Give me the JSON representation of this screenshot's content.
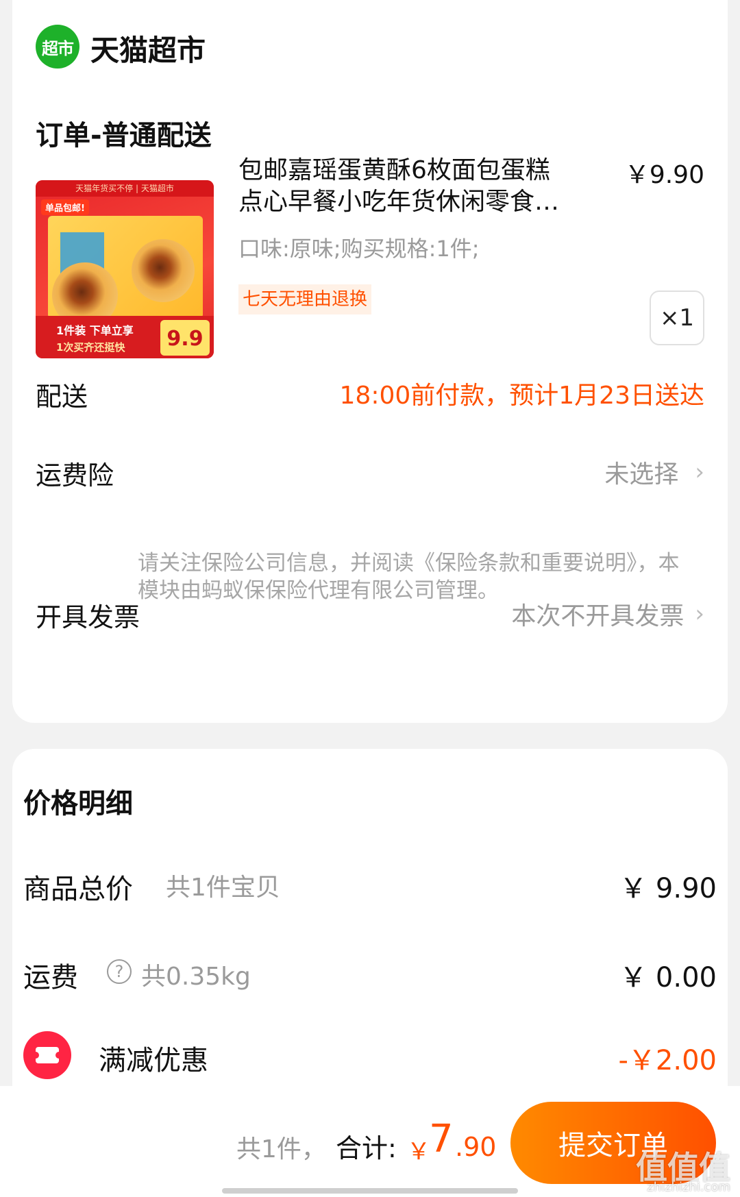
{
  "store": {
    "logo_text": "超市",
    "name": "天猫超市"
  },
  "order_section": {
    "title": "订单-普通配送"
  },
  "product": {
    "title_line1": "包邮嘉瑶蛋黄酥6枚面包蛋糕",
    "title_line2": "点心早餐小吃年货休闲零食2…",
    "price": "￥9.90",
    "spec": "口味:原味;购买规格:1件;",
    "return_tag": "七天无理由退换",
    "quantity": "×1",
    "thumb": {
      "banner": "天猫年货买不停 | 天猫超市",
      "free_tag": "单品包邮!",
      "promo_line1": "1件装 下单立享",
      "promo_line2": "1次买齐还挺快",
      "price": "9.9"
    }
  },
  "delivery": {
    "label": "配送",
    "value": "18:00前付款，预计1月23日送达"
  },
  "shipping_insurance": {
    "label": "运费险",
    "value": "未选择",
    "note": "请关注保险公司信息，并阅读《保险条款和重要说明》，本模块由蚂蚁保保险代理有限公司管理。"
  },
  "invoice": {
    "label": "开具发票",
    "value": "本次不开具发票"
  },
  "price_details": {
    "title": "价格明细",
    "goods_total_label": "商品总价",
    "goods_total_sub": "共1件宝贝",
    "goods_total_amount": "￥ 9.90",
    "freight_label": "运费",
    "freight_sub": "共0.35kg",
    "freight_amount": "￥ 0.00",
    "discount_label": "满减优惠",
    "discount_amount": "-￥2.00"
  },
  "bottom_bar": {
    "count": "共1件，",
    "total_label": "合计:",
    "currency": "￥",
    "total_int": "7",
    "total_dec": ".90",
    "submit_label": "提交订单"
  },
  "watermark": {
    "text": "值值值",
    "url": "zhizhizhi.com"
  },
  "colors": {
    "accent": "#ff5000",
    "tmall_green": "#1eb12a",
    "coupon_red": "#ff2443"
  }
}
